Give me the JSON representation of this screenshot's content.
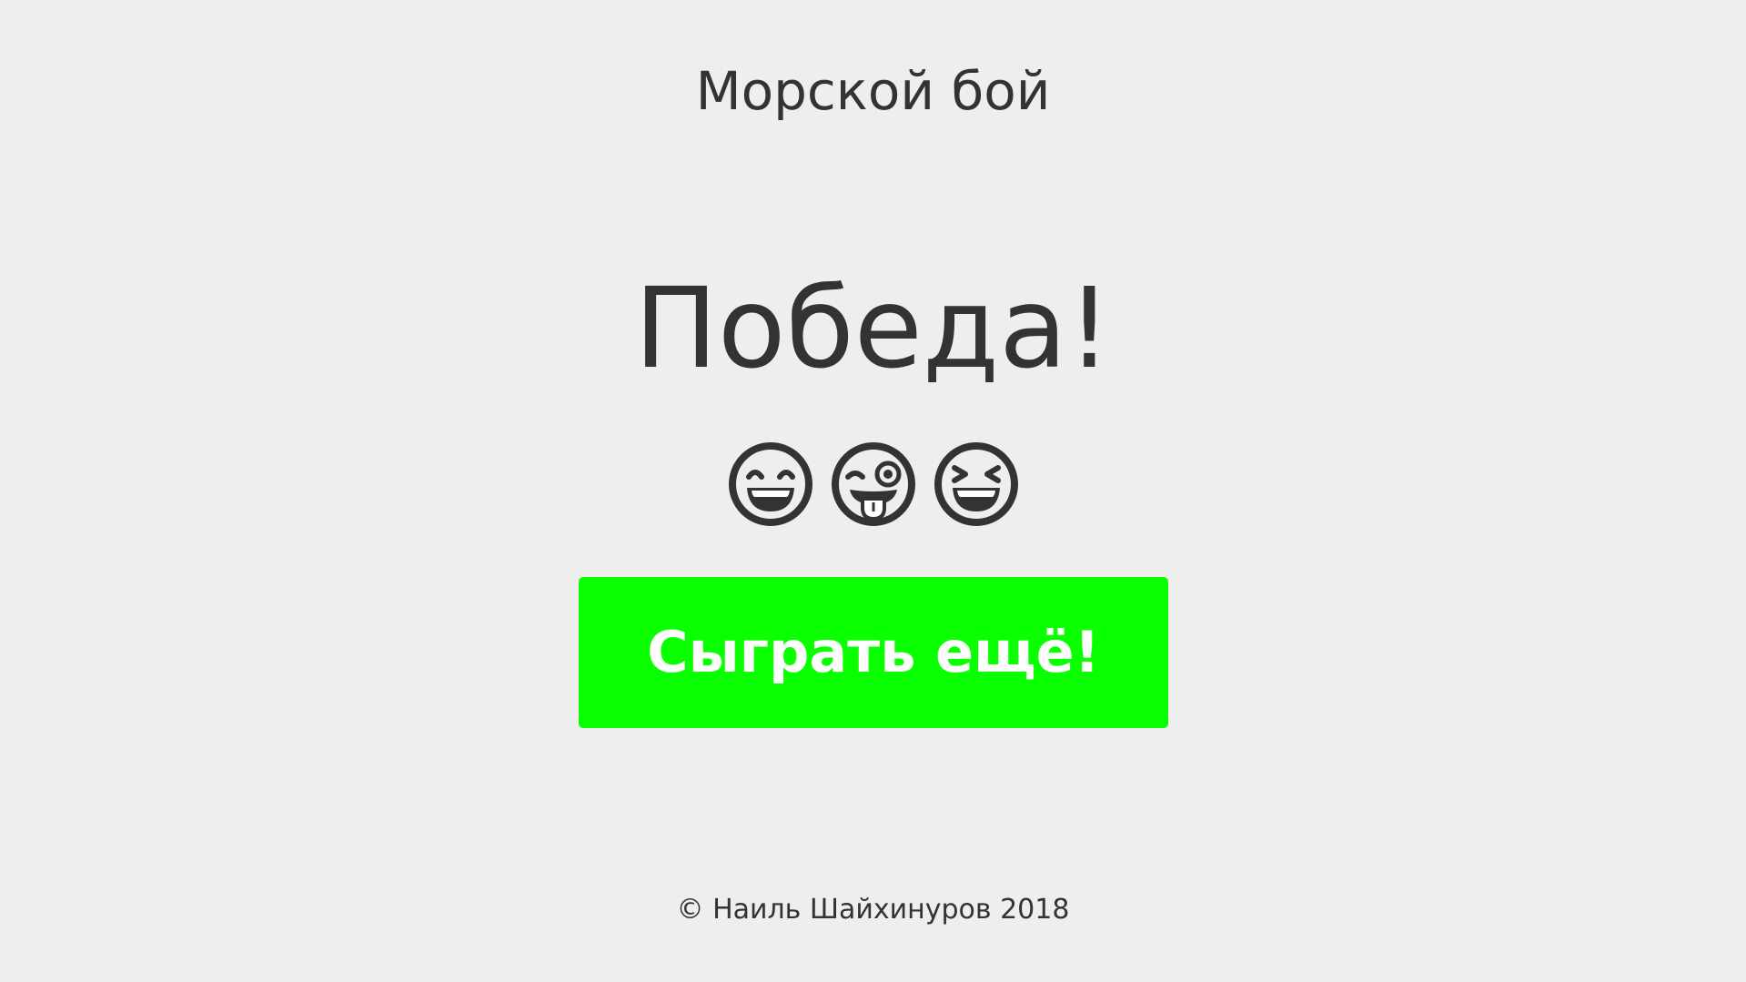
{
  "header": {
    "title": "Морской бой"
  },
  "main": {
    "result_text": "Победа!",
    "emojis": [
      {
        "icon": "grinning-face-icon"
      },
      {
        "icon": "winking-face-with-tongue-icon"
      },
      {
        "icon": "laughing-squinting-face-icon"
      }
    ],
    "play_again_label": "Сыграть ещё!"
  },
  "footer": {
    "copyright": "© Наиль Шайхинуров 2018"
  },
  "colors": {
    "background": "#eeeeee",
    "text": "#333333",
    "button": "#0aff00",
    "button_text": "#ffffff"
  }
}
